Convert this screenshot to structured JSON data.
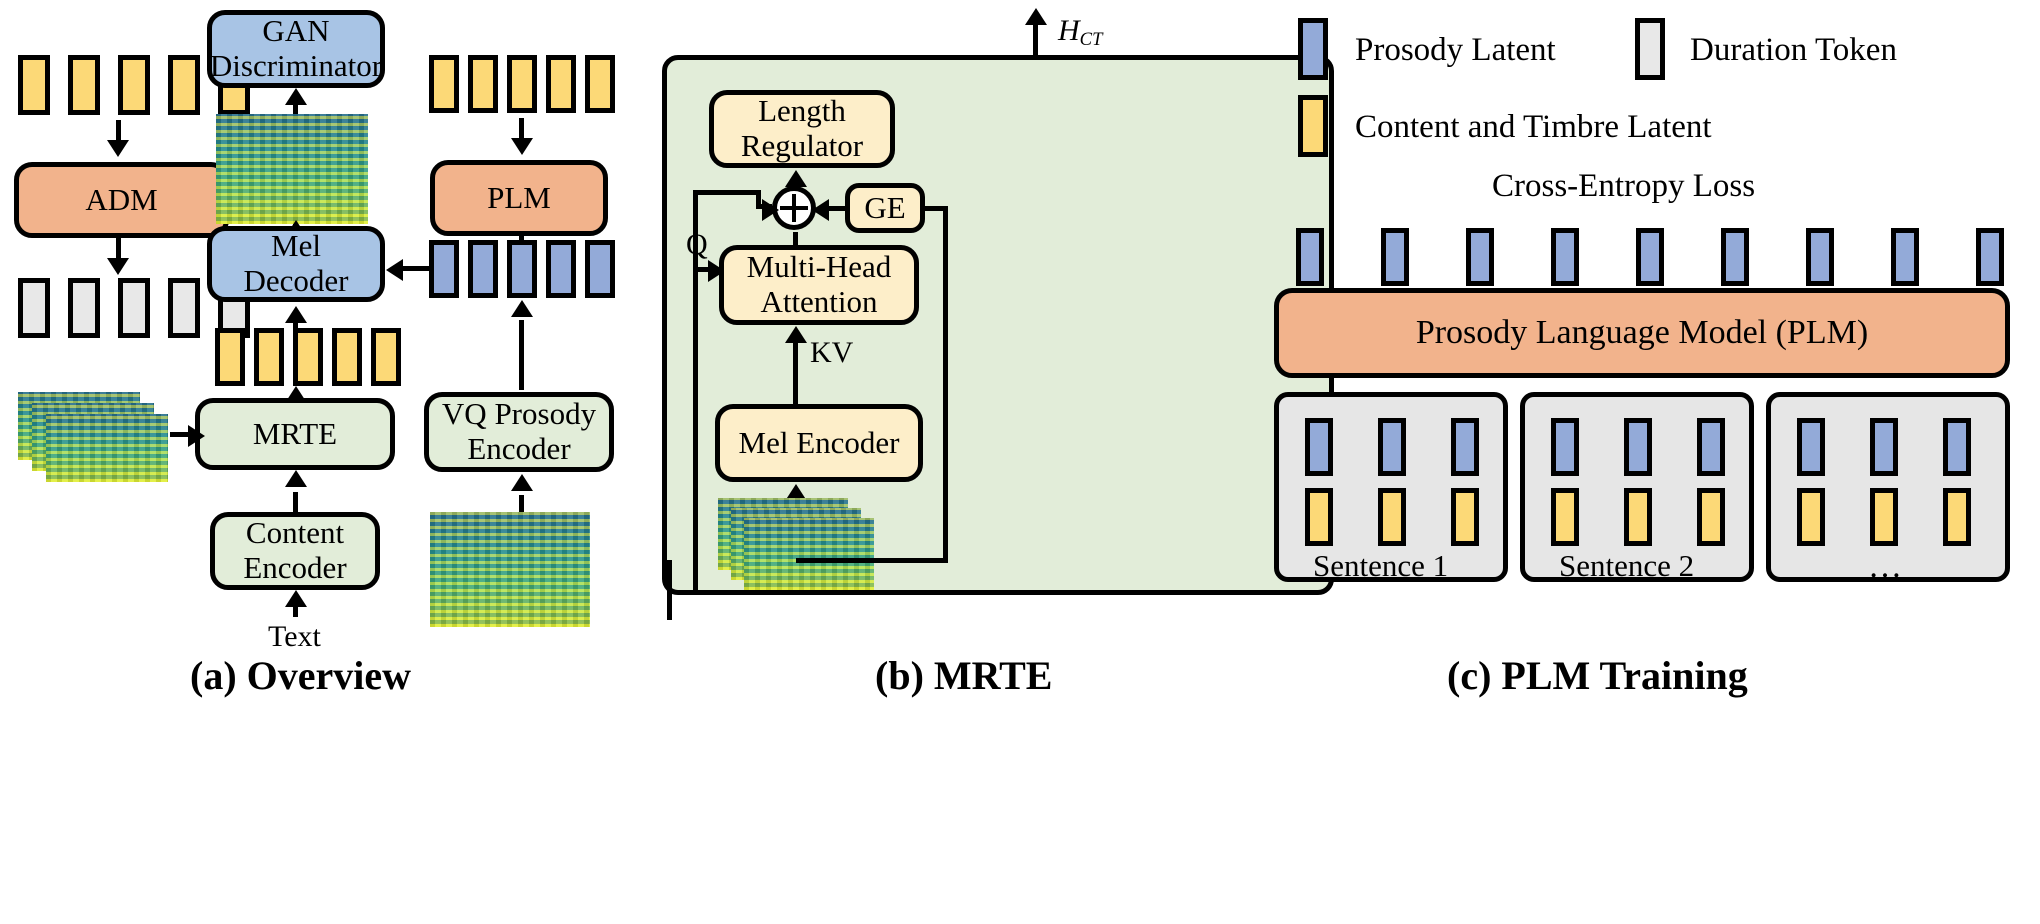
{
  "figure": {
    "panels": [
      {
        "id": "a",
        "caption": "(a) Overview"
      },
      {
        "id": "b",
        "caption": "(b) MRTE"
      },
      {
        "id": "c",
        "caption": "(c) PLM Training"
      }
    ]
  },
  "panel_a": {
    "nodes": {
      "adm": "ADM",
      "gan_discriminator": "GAN\nDiscriminator",
      "plm": "PLM",
      "mel_decoder": "Mel\nDecoder",
      "mrte": "MRTE",
      "vq_prosody_encoder": "VQ Prosody\nEncoder",
      "content_encoder": "Content\nEncoder"
    },
    "labels": {
      "text_input": "Text"
    },
    "token_rows": {
      "adm_input_yellow": 5,
      "adm_output_grey": 5,
      "plm_input_yellow": 5,
      "plm_output_blue": 5,
      "mrte_output_yellow": 5
    }
  },
  "panel_b": {
    "output_label": "H",
    "output_sub": "CT",
    "nodes": {
      "length_regulator": "Length\nRegulator",
      "multi_head_attention": "Multi-Head\nAttention",
      "mel_encoder": "Mel Encoder",
      "ge": "GE"
    },
    "edge_labels": {
      "query": "Q",
      "keyvalue": "KV"
    }
  },
  "panel_c": {
    "loss_label": "Cross-Entropy Loss",
    "plm_box": "Prosody Language Model (PLM)",
    "output_token_count": 9,
    "sentences": [
      {
        "label": "Sentence 1",
        "tokens": 3
      },
      {
        "label": "Sentence 2",
        "tokens": 3
      },
      {
        "label": "…",
        "tokens": 3
      }
    ]
  },
  "legend": {
    "items": [
      {
        "swatch": "prosody-latent-swatch",
        "color": "#93aad8",
        "label": "Prosody Latent"
      },
      {
        "swatch": "duration-token-swatch",
        "color": "#e8e8e8",
        "label": "Duration Token"
      },
      {
        "swatch": "content-timbre-latent-swatch",
        "color": "#fcd977",
        "label": "Content and Timbre Latent"
      }
    ]
  },
  "colors": {
    "blue_box": "#a8c4e5",
    "orange_box": "#f2b38c",
    "green_box": "#e2edd9",
    "cream_box": "#fdeec9",
    "grey_box": "#e6e6e6",
    "yellow_chip": "#fcd977",
    "blue_chip": "#93aad8",
    "grey_chip": "#e8e8e8",
    "stroke": "#000000"
  }
}
